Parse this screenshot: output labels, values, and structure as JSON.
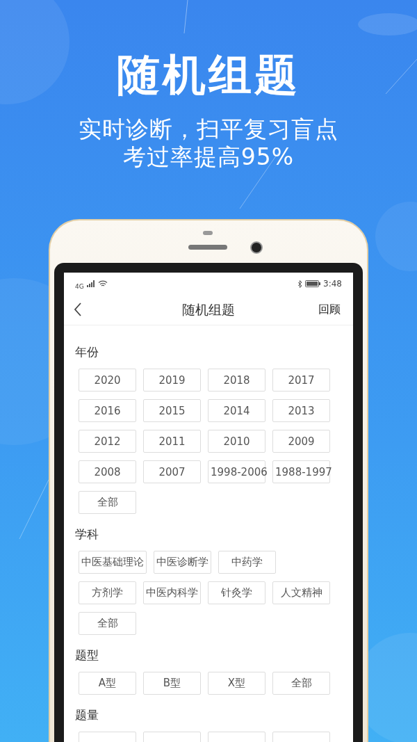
{
  "hero": {
    "title": "随机组题",
    "subtitle_lines": [
      "实时诊断，扫平复习盲点",
      "考过率提高95%"
    ]
  },
  "status_bar": {
    "network": "4G",
    "time": "3:48"
  },
  "header": {
    "title": "随机组题",
    "action": "回顾"
  },
  "sections": [
    {
      "label": "年份",
      "kind": "grid",
      "options": [
        {
          "text": "2020"
        },
        {
          "text": "2019"
        },
        {
          "text": "2018"
        },
        {
          "text": "2017"
        },
        {
          "text": "2016"
        },
        {
          "text": "2015"
        },
        {
          "text": "2014"
        },
        {
          "text": "2013"
        },
        {
          "text": "2012"
        },
        {
          "text": "2011"
        },
        {
          "text": "2010"
        },
        {
          "text": "2009"
        },
        {
          "text": "2008"
        },
        {
          "text": "2007"
        },
        {
          "text": "1998-2006"
        },
        {
          "text": "1988-1997"
        },
        {
          "text": "全部"
        }
      ]
    },
    {
      "label": "学科",
      "kind": "rows",
      "rows": [
        [
          {
            "text": "中医基础理论"
          },
          {
            "text": "中医诊断学"
          },
          {
            "text": "中药学"
          }
        ],
        [
          {
            "text": "方剂学"
          },
          {
            "text": "中医内科学"
          },
          {
            "text": "针灸学"
          },
          {
            "text": "人文精神"
          }
        ],
        [
          {
            "text": "全部"
          }
        ]
      ]
    },
    {
      "label": "题型",
      "kind": "grid",
      "options": [
        {
          "text": "A型"
        },
        {
          "text": "B型"
        },
        {
          "text": "X型"
        },
        {
          "text": "全部"
        }
      ]
    },
    {
      "label": "题量",
      "kind": "grid",
      "options": [
        {
          "kind": "cut"
        },
        {
          "kind": "cut"
        },
        {
          "kind": "cut"
        },
        {
          "kind": "cut"
        }
      ]
    }
  ]
}
